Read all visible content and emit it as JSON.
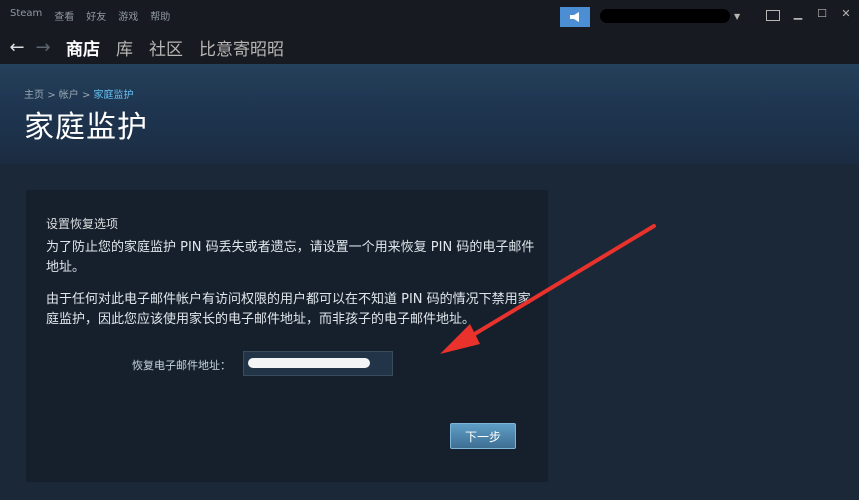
{
  "titlebar": {
    "menu": [
      "Steam",
      "查看",
      "好友",
      "游戏",
      "帮助"
    ]
  },
  "nav": {
    "links": [
      "商店",
      "库",
      "社区",
      "比意寄昭昭"
    ]
  },
  "header": {
    "breadcrumb": {
      "home": "主页",
      "account": "帐户",
      "current": "家庭监护"
    },
    "title": "家庭监护"
  },
  "panel": {
    "section_title": "设置恢复选项",
    "para1": "为了防止您的家庭监护 PIN 码丢失或者遗忘，请设置一个用来恢复 PIN 码的电子邮件地址。",
    "para2": "由于任何对此电子邮件帐户有访问权限的用户都可以在不知道 PIN 码的情况下禁用家庭监护，因此您应该使用家长的电子邮件地址，而非孩子的电子邮件地址。",
    "email_label": "恢复电子邮件地址：",
    "email_value": "",
    "next_label": "下一步"
  },
  "colors": {
    "accent": "#66c0f4",
    "annotation_arrow": "#e8322b"
  }
}
